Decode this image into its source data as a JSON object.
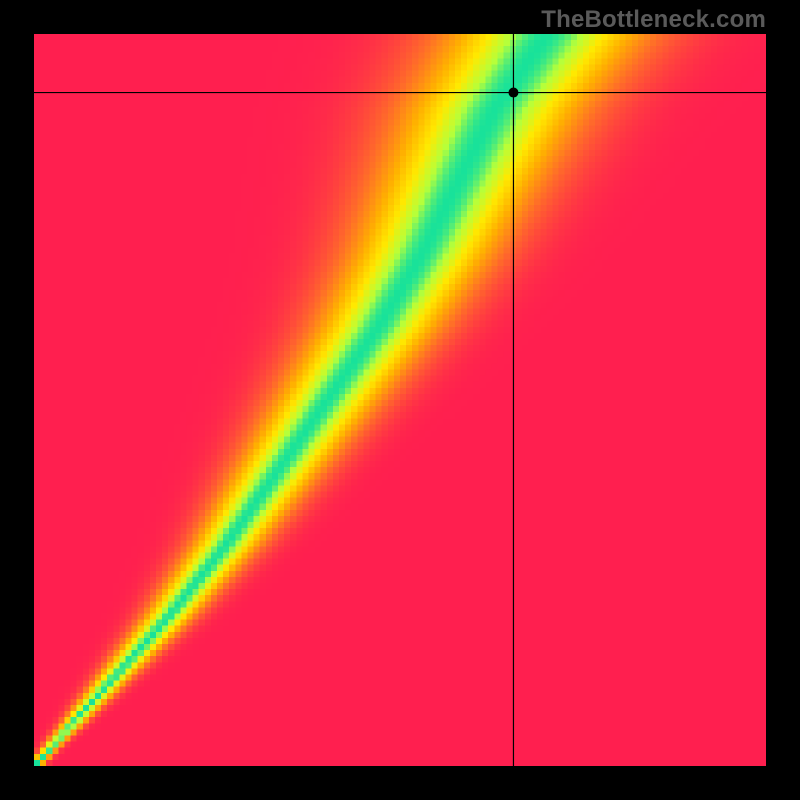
{
  "watermark": "TheBottleneck.com",
  "chart_data": {
    "type": "heatmap",
    "title": "",
    "xlabel": "",
    "ylabel": "",
    "x_range": [
      0,
      100
    ],
    "y_range": [
      0,
      100
    ],
    "grid": false,
    "legend": false,
    "colormap_stops": [
      {
        "t": 0.0,
        "color": "#ff1f4f"
      },
      {
        "t": 0.3,
        "color": "#ff6a2a"
      },
      {
        "t": 0.55,
        "color": "#ffb000"
      },
      {
        "t": 0.75,
        "color": "#ffe900"
      },
      {
        "t": 0.9,
        "color": "#b6ff3a"
      },
      {
        "t": 1.0,
        "color": "#18e29a"
      }
    ],
    "optimal_ridge": {
      "description": "Center line of the green band; x as a function of y (both 0-100). Points approximated from the pixels.",
      "points": [
        {
          "y": 0,
          "x": 0
        },
        {
          "y": 10,
          "x": 9
        },
        {
          "y": 20,
          "x": 18
        },
        {
          "y": 30,
          "x": 26
        },
        {
          "y": 40,
          "x": 33
        },
        {
          "y": 50,
          "x": 40
        },
        {
          "y": 60,
          "x": 47
        },
        {
          "y": 70,
          "x": 53
        },
        {
          "y": 80,
          "x": 58
        },
        {
          "y": 90,
          "x": 63
        },
        {
          "y": 100,
          "x": 70
        }
      ]
    },
    "ridge_halfwidth": {
      "at_y_0": 0.5,
      "at_y_100": 8
    },
    "marker": {
      "x": 65.5,
      "y": 92,
      "radius_px": 5
    },
    "crosshair": {
      "vertical_x": 65.5,
      "horizontal_y": 92
    },
    "pixel_grid": 120
  }
}
